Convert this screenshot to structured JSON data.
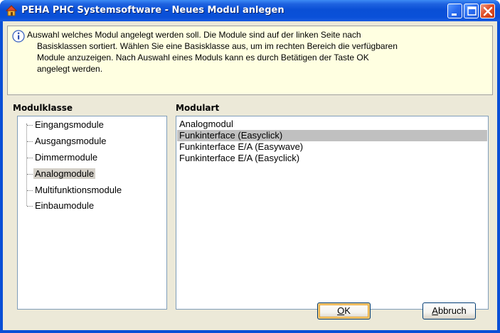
{
  "window": {
    "title": "PEHA PHC Systemsoftware - Neues Modul anlegen",
    "icon": "house-icon",
    "controls": [
      "minimize-icon",
      "maximize-icon",
      "close-icon"
    ]
  },
  "info": {
    "icon": "info-icon",
    "line1": "Auswahl welches Modul angelegt werden soll. Die Module sind auf der linken Seite nach",
    "line2": "Basisklassen sortiert. Wählen Sie eine Basisklasse aus, um im rechten Bereich die verfügbaren",
    "line3": "Module anzuzeigen. Nach Auswahl eines Moduls kann es durch Betätigen der Taste OK",
    "line4": "angelegt werden."
  },
  "modulklasse": {
    "label": "Modulklasse",
    "items": [
      {
        "label": "Eingangsmodule",
        "selected": false
      },
      {
        "label": "Ausgangsmodule",
        "selected": false
      },
      {
        "label": "Dimmermodule",
        "selected": false
      },
      {
        "label": "Analogmodule",
        "selected": true
      },
      {
        "label": "Multifunktionsmodule",
        "selected": false
      },
      {
        "label": "Einbaumodule",
        "selected": false
      }
    ]
  },
  "modulart": {
    "label": "Modulart",
    "items": [
      {
        "label": "Analogmodul",
        "selected": false
      },
      {
        "label": "Funkinterface (Easyclick)",
        "selected": true
      },
      {
        "label": "Funkinterface E/A (Easywave)",
        "selected": false
      },
      {
        "label": "Funkinterface E/A (Easyclick)",
        "selected": false
      }
    ]
  },
  "buttons": {
    "ok_mnemonic": "O",
    "ok_rest": "K",
    "cancel_mnemonic": "A",
    "cancel_rest": "bbruch"
  },
  "colors": {
    "titlebar": "#0a4fd6",
    "client_bg": "#ece9d8",
    "info_bg": "#ffffe1",
    "selection": "#c0c0c0"
  }
}
